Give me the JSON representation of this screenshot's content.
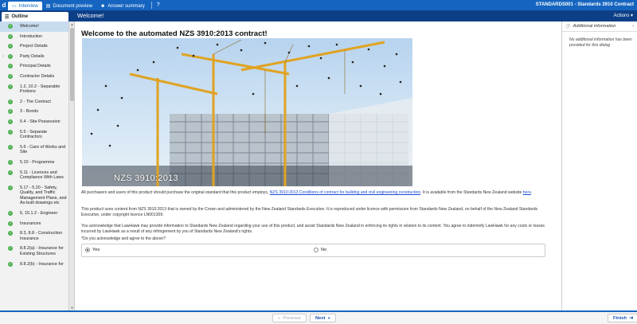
{
  "app": {
    "logo": "d",
    "doc_id": "STANDARDS001 - Standards 3910 Contract",
    "help": "?"
  },
  "tabs": [
    {
      "label": "Interview",
      "icon": "monitor-icon",
      "active": true
    },
    {
      "label": "Document preview",
      "icon": "document-icon",
      "active": false
    },
    {
      "label": "Answer summary",
      "icon": "people-icon",
      "active": false
    }
  ],
  "subbar": {
    "outline_label": "Outline",
    "page_heading": "Welcome!",
    "actions_label": "Actions ▾"
  },
  "outline": [
    {
      "label": "Welcome!",
      "done": true,
      "active": true
    },
    {
      "label": "Introduction",
      "done": true
    },
    {
      "label": "Project Details",
      "done": true
    },
    {
      "label": "Party Details",
      "done": true,
      "expandable": true
    },
    {
      "label": "Principal Details",
      "done": true
    },
    {
      "label": "Contractor Details",
      "done": true
    },
    {
      "label": "1.2, 10.2 - Separable Portions",
      "done": true
    },
    {
      "label": "2 - The Contract",
      "done": true
    },
    {
      "label": "3 - Bonds",
      "done": true
    },
    {
      "label": "5.4 - Site Possession",
      "done": true
    },
    {
      "label": "5.5 - Separate Contractors",
      "done": true
    },
    {
      "label": "5.6 - Care of Works and Site",
      "done": true
    },
    {
      "label": "5.10 - Programme",
      "done": true
    },
    {
      "label": "5.11 - Licences and Compliance With Laws",
      "done": true
    },
    {
      "label": "5.17 - 5.20 - Safety, Quality, and Traffic Management Plans, and As-built drawings etc",
      "done": true
    },
    {
      "label": "6, 15.1.2 - Engineer",
      "done": true
    },
    {
      "label": "Insurances",
      "done": true
    },
    {
      "label": "8.3, 8.8 - Construction Insurance",
      "done": true
    },
    {
      "label": "8.8.2(a) - Insurance for Existing Structures",
      "done": true
    },
    {
      "label": "8.8.2(b) - Insurance for",
      "done": true
    }
  ],
  "main": {
    "title": "Welcome to the automated NZS 3910:2013 contract!",
    "hero_text": "NZS 3910:2013",
    "p1_before": "All purchasers and users of this product should purchase the original standard that this product employs, ",
    "p1_link": "NZS 3910:2013 Conditions of contract for building and civil engineering construction",
    "p1_mid": ". It is available from the Standards New Zealand website ",
    "p1_link2": "here",
    "p1_end": ".",
    "p2": "This product uses content from NZS 3910:2013 that is owned by the Crown and administered by the New Zealand Standards Executive. It is reproduced under licence with permission from Standards New Zealand, on behalf of the New Zealand Standards Executive, under copyright licence LN001309.",
    "p3": "You acknowledge that LawHawk may provide information to Standards New Zealand regarding your use of this product, and assist Standards New Zealand in enforcing its rights in relation to its content. You agree to indemnify LawHawk for any costs or losses incurred by LawHawk as a result of any infringement by you of Standards New Zealand's rights.",
    "question": "*Do you acknowledge and agree to the above?",
    "option_yes": "Yes",
    "option_no": "No",
    "selected": "Yes"
  },
  "right_panel": {
    "title": "Additional information",
    "body": "No additional information has been provided for this dialog"
  },
  "footer": {
    "previous": "Previous",
    "next": "Next",
    "finish": "Finish"
  },
  "colors": {
    "primary": "#1565c0",
    "header_dark": "#0d3f87",
    "done_green": "#4caf50",
    "active_item": "#c8dcef",
    "link": "#1a4ad6"
  }
}
